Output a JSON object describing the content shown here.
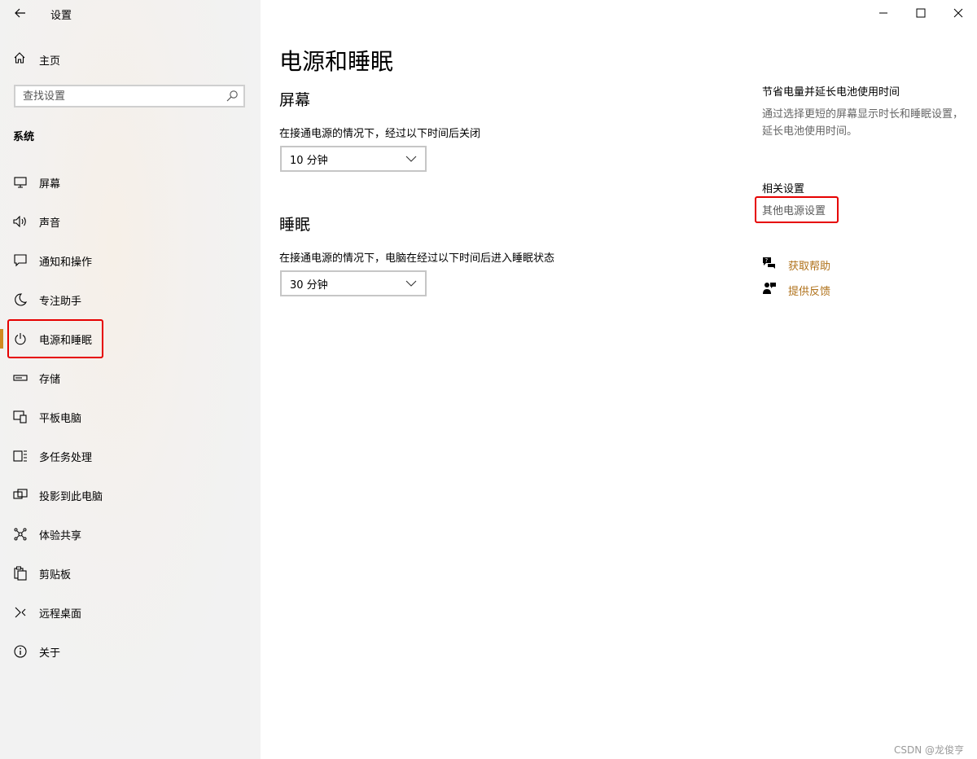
{
  "window": {
    "title": "设置",
    "controls": [
      "minimize",
      "maximize",
      "close"
    ]
  },
  "sidebar": {
    "home_label": "主页",
    "search": {
      "placeholder": "查找设置"
    },
    "section_label": "系统",
    "items": [
      {
        "label": "屏幕",
        "icon": "monitor-icon",
        "active": false
      },
      {
        "label": "声音",
        "icon": "speaker-icon",
        "active": false
      },
      {
        "label": "通知和操作",
        "icon": "message-icon",
        "active": false
      },
      {
        "label": "专注助手",
        "icon": "moon-icon",
        "active": false
      },
      {
        "label": "电源和睡眠",
        "icon": "power-icon",
        "active": true
      },
      {
        "label": "存储",
        "icon": "storage-icon",
        "active": false
      },
      {
        "label": "平板电脑",
        "icon": "tablet-icon",
        "active": false
      },
      {
        "label": "多任务处理",
        "icon": "multitask-icon",
        "active": false
      },
      {
        "label": "投影到此电脑",
        "icon": "project-icon",
        "active": false
      },
      {
        "label": "体验共享",
        "icon": "share-icon",
        "active": false
      },
      {
        "label": "剪贴板",
        "icon": "clipboard-icon",
        "active": false
      },
      {
        "label": "远程桌面",
        "icon": "remote-icon",
        "active": false
      },
      {
        "label": "关于",
        "icon": "info-icon",
        "active": false
      }
    ]
  },
  "main": {
    "title": "电源和睡眠",
    "screen": {
      "heading": "屏幕",
      "description": "在接通电源的情况下，经过以下时间后关闭",
      "value": "10 分钟"
    },
    "sleep": {
      "heading": "睡眠",
      "description": "在接通电源的情况下，电脑在经过以下时间后进入睡眠状态",
      "value": "30 分钟"
    }
  },
  "right_panel": {
    "tip_heading": "节省电量并延长电池使用时间",
    "tip_text": "通过选择更短的屏幕显示时长和睡眠设置，延长电池使用时间。",
    "related_heading": "相关设置",
    "related_link": "其他电源设置",
    "help_link": "获取帮助",
    "feedback_link": "提供反馈"
  },
  "colors": {
    "accent": "#d08a1f",
    "link": "#b0721b",
    "highlight": "#e60000"
  },
  "watermark": "CSDN @龙俊亨"
}
